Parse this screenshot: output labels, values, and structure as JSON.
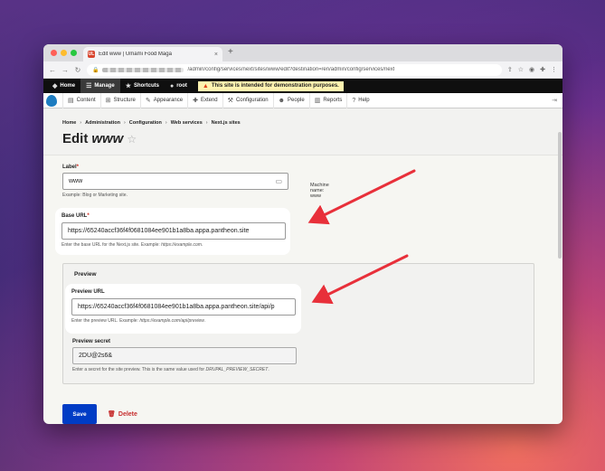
{
  "browser": {
    "tab_favicon": "UL",
    "tab_title": "Edit www | Umami Food Maga",
    "tab_close": "×",
    "new_tab": "+",
    "url_visible": "/admin/config/services/next/sites/www/edit?destination=/en/admin/config/services/next",
    "icons": [
      "back-arrow-icon",
      "forward-arrow-icon",
      "reload-icon",
      "share-icon",
      "star-icon",
      "extension-icon",
      "puzzle-icon",
      "menu-icon"
    ]
  },
  "admin_toolbar": {
    "items": [
      {
        "label": "Home",
        "icon": "drupal-drop-icon"
      },
      {
        "label": "Manage",
        "icon": "hamburger-icon"
      },
      {
        "label": "Shortcuts",
        "icon": "star-icon"
      },
      {
        "label": "root",
        "icon": "user-icon"
      }
    ],
    "notice": "This site is intended for demonstration purposes."
  },
  "admin_menu": [
    {
      "label": "Content",
      "icon": "document-icon"
    },
    {
      "label": "Structure",
      "icon": "structure-icon"
    },
    {
      "label": "Appearance",
      "icon": "brush-icon"
    },
    {
      "label": "Extend",
      "icon": "puzzle-icon"
    },
    {
      "label": "Configuration",
      "icon": "wrench-icon"
    },
    {
      "label": "People",
      "icon": "people-icon"
    },
    {
      "label": "Reports",
      "icon": "chart-icon"
    },
    {
      "label": "Help",
      "icon": "help-icon"
    }
  ],
  "breadcrumb": [
    "Home",
    "Administration",
    "Configuration",
    "Web services",
    "Next.js sites"
  ],
  "page": {
    "title_prefix": "Edit",
    "title_name": "www"
  },
  "form": {
    "label": {
      "label": "Label",
      "value": "www",
      "machine_name": "Machine name: www",
      "help": "Example: Blog or Marketing site."
    },
    "base_url": {
      "label": "Base URL",
      "value": "https://65240accf36f4f0681084ee901b1a8ba.appa.pantheon.site",
      "help_prefix": "Enter the base URL for the Next.js site. Example: ",
      "help_example": "https://example.com"
    },
    "preview": {
      "legend": "Preview",
      "preview_url": {
        "label": "Preview URL",
        "value": "https://65240accf36f4f0681084ee901b1a8ba.appa.pantheon.site/api/p",
        "help_prefix": "Enter the preview URL. Example: ",
        "help_example": "https://example.com/api/preview"
      },
      "preview_secret": {
        "label": "Preview secret",
        "value": "2DU@2s6&",
        "help_prefix": "Enter a secret for the site preview. This is the same value used for ",
        "help_example": "DRUPAL_PREVIEW_SECRET"
      }
    },
    "save_label": "Save",
    "delete_label": "Delete"
  },
  "colors": {
    "primary_button": "#003cc5",
    "danger": "#c72f2f",
    "required": "#d3271b",
    "annotation_arrow": "#e8303a"
  }
}
